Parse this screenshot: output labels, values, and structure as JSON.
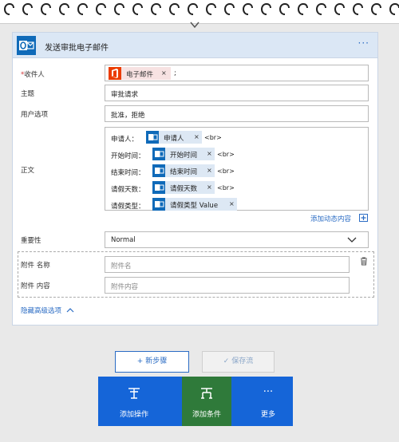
{
  "card": {
    "title": "发送审批电子邮件",
    "more": "···",
    "fields": {
      "to_label": "收件人",
      "to_required": "*",
      "to_token": "电子邮件",
      "to_token_remove": "×",
      "to_separator": ";",
      "subject_label": "主题",
      "subject_value": "审批请求",
      "options_label": "用户选项",
      "options_value": "批准，拒绝",
      "body_label": "正文",
      "body_rows": [
        {
          "label": "申请人：",
          "token": "申请人",
          "remove": "×",
          "br": "<br>"
        },
        {
          "label": "开始时间：",
          "token": "开始时间",
          "remove": "×",
          "br": "<br>"
        },
        {
          "label": "结束时间：",
          "token": "结束时间",
          "remove": "×",
          "br": "<br>"
        },
        {
          "label": "请假天数：",
          "token": "请假天数",
          "remove": "×",
          "br": "<br>"
        },
        {
          "label": "请假类型：",
          "token": "请假类型 Value",
          "remove": "×",
          "br": ""
        }
      ],
      "add_dynamic": "添加动态内容",
      "importance_label": "重要性",
      "importance_value": "Normal",
      "attach_name_label": "附件 名称",
      "attach_name_placeholder": "附件名",
      "attach_content_label": "附件 内容",
      "attach_content_placeholder": "附件内容",
      "hide_advanced": "隐藏高级选项"
    }
  },
  "actions": {
    "new_step": "+ 新步骤",
    "save_flow": "✓ 保存流"
  },
  "menu": {
    "add_action": "添加操作",
    "add_condition": "添加条件",
    "more": "更多",
    "more_icon": "···"
  },
  "colors": {
    "accent": "#1565d8",
    "condition": "#2f7a3a",
    "outlook": "#0f6ab9",
    "office": "#eb3c00"
  }
}
